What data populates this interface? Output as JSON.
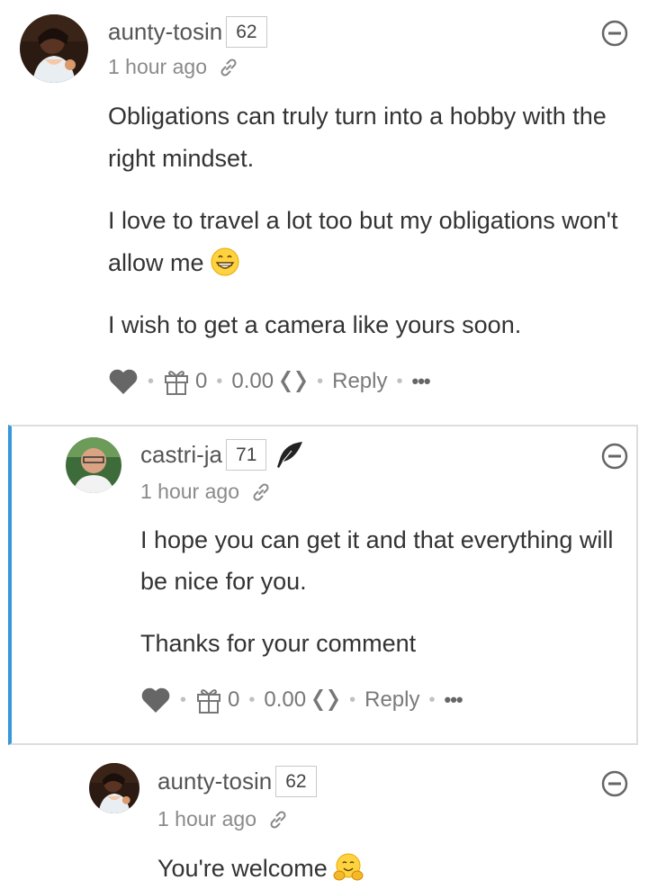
{
  "comments": [
    {
      "author": "aunty-tosin",
      "reputation": "62",
      "time": "1 hour ago",
      "paragraphs": [
        "Obligations can truly turn into a hobby with the right mindset.",
        "I love to travel a lot too but my obligations won't allow me",
        "I wish to get a camera like yours soon."
      ],
      "emoji": "grinning-face",
      "gift_count": "0",
      "payout": "0.00",
      "reply_label": "Reply",
      "more_label": "•••"
    },
    {
      "author": "castri-ja",
      "reputation": "71",
      "time": "1 hour ago",
      "paragraphs": [
        "I hope you can get it and that everything will be nice for you.",
        "Thanks for your comment"
      ],
      "gift_count": "0",
      "payout": "0.00",
      "reply_label": "Reply",
      "more_label": "•••"
    },
    {
      "author": "aunty-tosin",
      "reputation": "62",
      "time": "1 hour ago",
      "paragraphs": [
        "You're welcome"
      ],
      "emoji": "hugging-face"
    }
  ],
  "icons": {
    "collapse": "minus-circle-icon",
    "permalink": "link-icon",
    "upvote": "heart-icon",
    "gift": "gift-icon",
    "currency": "hive-icon",
    "author-badge": "feather-icon"
  },
  "colors": {
    "thread_accent": "#3498db",
    "text": "#333333",
    "muted": "#8a8a8a"
  }
}
